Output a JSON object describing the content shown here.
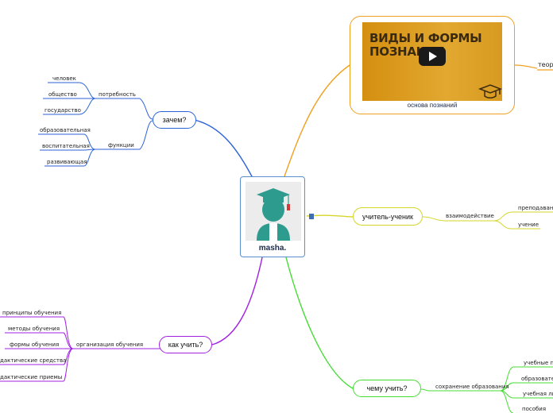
{
  "center": {
    "title": "masha."
  },
  "branches": {
    "why": {
      "label": "зачем?",
      "color": "#2c62d8"
    },
    "how": {
      "label": "как учить?",
      "color": "#a020e0"
    },
    "what": {
      "label": "чему учить?",
      "color": "#44dd33"
    },
    "teacher": {
      "label": "учитель-ученик",
      "color": "#d6d62a"
    },
    "basis": {
      "label": "основа познаний",
      "color": "#f0a020"
    }
  },
  "video": {
    "title": "ВИДЫ И ФОРМЫ ПОЗНАНИЯ",
    "caption": "основа познаний",
    "side_label": "теор"
  },
  "why_subs": {
    "need": "потребность",
    "need_items": [
      "человек",
      "общество",
      "государство"
    ],
    "func": "функции",
    "func_items": [
      "образовательная",
      "воспитательная",
      "развивающая"
    ]
  },
  "teacher_subs": {
    "interaction": "взаимодействие",
    "items": [
      "преподавание",
      "учение"
    ]
  },
  "how_subs": {
    "org": "организация обучения",
    "items": [
      "принципы обучения",
      "методы обучения",
      "формы обучения",
      "дактические средства",
      "дактические приемы"
    ]
  },
  "what_subs": {
    "content": "сохранение образования",
    "items": [
      "учебные пла",
      "образователь",
      "учебная лите",
      "пособия"
    ]
  }
}
